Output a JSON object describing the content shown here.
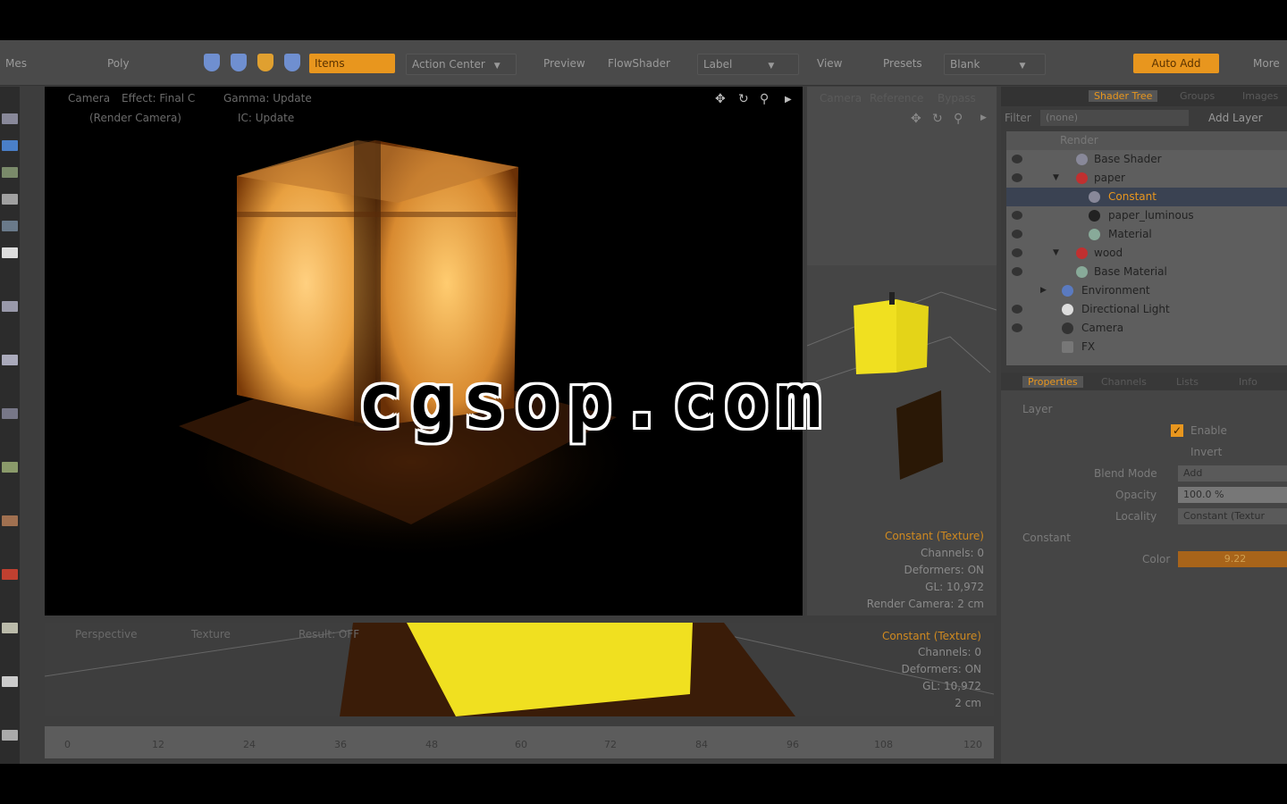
{
  "toolbar": {
    "items_left": [
      "Mes",
      "Poly"
    ],
    "items_tab": "Items",
    "action_center": "Action Center",
    "preview": "Preview",
    "flow_shader": "FlowShader",
    "layout": "Label",
    "view": "View",
    "presets": "Presets",
    "blank": "Blank",
    "auto_add": "Auto Add",
    "more": "More"
  },
  "viewport_main": {
    "header_left": "Camera",
    "header_mid": "Effect: Final C",
    "header_right": "Gamma: Update",
    "sub_left": "(Render Camera)",
    "sub_right": "IC: Update"
  },
  "viewport_right": {
    "tabs": [
      "Camera",
      "Reference",
      "Bypass"
    ],
    "info": [
      "Constant (Texture)",
      "Channels: 0",
      "Deformers: ON",
      "GL: 10,972",
      "Render Camera: 2 cm"
    ]
  },
  "viewport_bottom": {
    "header": [
      "Perspective",
      "Texture",
      "Result: OFF"
    ],
    "info": [
      "Constant (Texture)",
      "Channels: 0",
      "Deformers: ON",
      "GL: 10,972",
      "2 cm"
    ]
  },
  "timeline": {
    "ticks": [
      "0",
      "12",
      "24",
      "36",
      "48",
      "60",
      "72",
      "84",
      "96",
      "108",
      "120"
    ]
  },
  "shader_tree": {
    "tabs": [
      "",
      "Shader Tree",
      "Groups",
      "Images"
    ],
    "filter_label": "Filter",
    "filter_value": "(none)",
    "add_layer": "Add Layer",
    "rows": [
      "Render",
      "Base Shader",
      "paper",
      "Constant",
      "paper_luminous",
      "Material",
      "wood",
      "Base Material",
      "Environment",
      "Directional Light",
      "Camera",
      "FX"
    ]
  },
  "properties": {
    "tabs": [
      "Properties",
      "Channels",
      "Lists",
      "Info"
    ],
    "section": "Layer",
    "enable": "Enable",
    "invert": "Invert",
    "blend_mode_label": "Blend Mode",
    "blend_mode_value": "Add",
    "opacity_label": "Opacity",
    "opacity_value": "100.0 %",
    "locality_label": "Locality",
    "locality_value": "Constant (Textur",
    "constant_section": "Constant",
    "color_label": "Color",
    "color_value": "9.22"
  },
  "watermark": "cgsop.com",
  "colors": {
    "accent": "#e8961e",
    "selection": "#e8e020"
  }
}
